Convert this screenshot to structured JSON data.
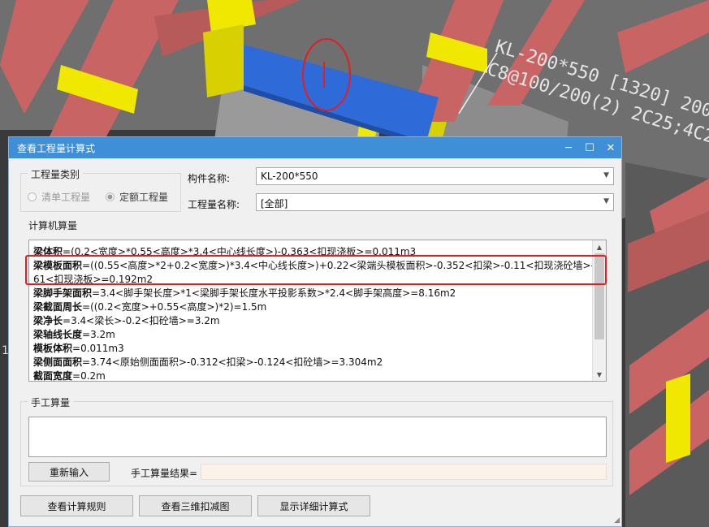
{
  "background": {
    "beam_label_line1": "KL-200*550 [1320] 200*",
    "beam_label_line2": "C8@100/200(2) 2C25;4C2",
    "edge_mark": "1",
    "colors": {
      "beam_red": "#c86464",
      "column_yellow": "#f0e800",
      "selected_beam": "#2f6bd8",
      "gray": "#a8a8a8"
    }
  },
  "dialog": {
    "title": "查看工程量计算式",
    "controls": {
      "minimize": "─",
      "maximize": "☐",
      "close": "✕"
    },
    "category_group": {
      "legend": "工程量类别",
      "options": [
        {
          "label": "清单工程量",
          "checked": false
        },
        {
          "label": "定额工程量",
          "checked": true
        }
      ]
    },
    "component_name": {
      "label": "构件名称:",
      "value": "KL-200*550"
    },
    "quantity_name": {
      "label": "工程量名称:",
      "value": "[全部]"
    },
    "computer_calc": {
      "legend": "计算机算量",
      "lines": [
        {
          "name": "梁体积",
          "formula": "=(0.2<宽度>*0.55<高度>*3.4<中心线长度>)-0.363<扣现浇板>=0.011m3"
        },
        {
          "name": "梁模板面积",
          "formula": "=((0.55<高度>*2+0.2<宽度>)*3.4<中心线长度>)+0.22<梁端头模板面积>-0.352<扣梁>-0.11<扣现浇砼墙>-3.98"
        },
        {
          "name": "",
          "formula": "61<扣现浇板>=0.192m2"
        },
        {
          "name": "梁脚手架面积",
          "formula": "=3.4<脚手架长度>*1<梁脚手架长度水平投影系数>*2.4<脚手架高度>=8.16m2"
        },
        {
          "name": "梁截面周长",
          "formula": "=((0.2<宽度>+0.55<高度>)*2)=1.5m"
        },
        {
          "name": "梁净长",
          "formula": "=3.4<梁长>-0.2<扣砼墙>=3.2m"
        },
        {
          "name": "梁轴线长度",
          "formula": "=3.2m"
        },
        {
          "name": "模板体积",
          "formula": "=0.011m3"
        },
        {
          "name": "梁侧面面积",
          "formula": "=3.74<原始侧面面积>-0.312<扣梁>-0.124<扣砼墙>=3.304m2"
        },
        {
          "name": "截面宽度",
          "formula": "=0.2m"
        }
      ],
      "scroll_up": "▲",
      "scroll_down": "▼"
    },
    "manual_calc": {
      "legend": "手工算量",
      "text": "",
      "reenter_button": "重新输入",
      "result_label": "手工算量结果=",
      "result_value": ""
    },
    "buttons": {
      "view_rules": "查看计算规则",
      "view_3d": "查看三维扣减图",
      "show_detail": "显示详细计算式"
    },
    "resize_grip": "◢"
  }
}
